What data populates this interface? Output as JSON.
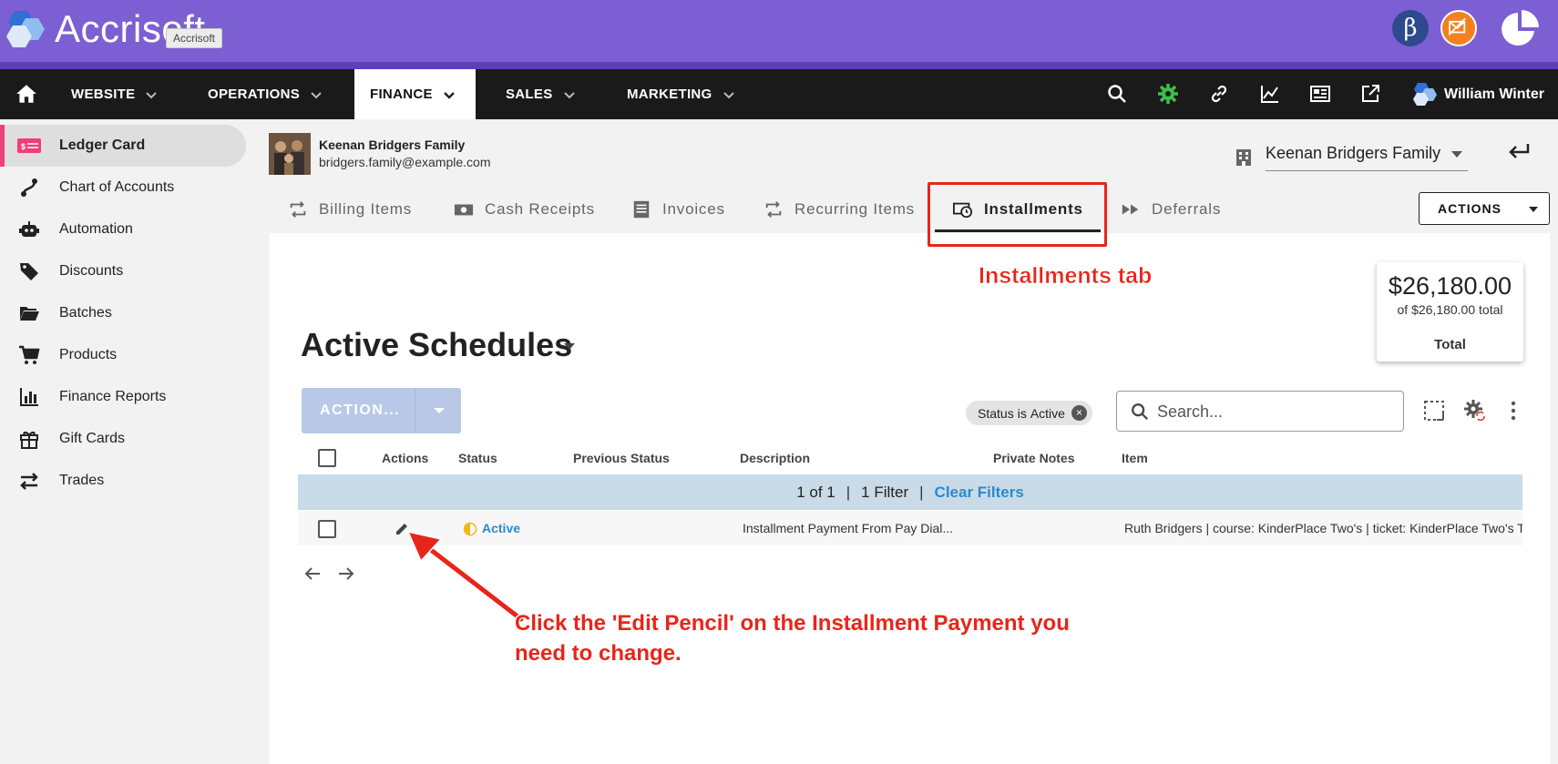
{
  "app": {
    "brand": "Accrisoft",
    "tooltip": "Accrisoft",
    "beta_glyph": "β",
    "colors": {
      "brand_purple": "#7b5fd3",
      "nav_dark": "#1a1a1a",
      "accent_pink": "#f03e7a",
      "link_blue": "#2a8ad1",
      "annotation_red": "#e8251b"
    }
  },
  "nav": {
    "items": [
      {
        "label": "WEBSITE"
      },
      {
        "label": "OPERATIONS"
      },
      {
        "label": "FINANCE"
      },
      {
        "label": "SALES"
      },
      {
        "label": "MARKETING"
      }
    ],
    "active": "FINANCE",
    "user": "William Winter",
    "icons": [
      "search-icon",
      "gear-icon",
      "link-icon",
      "analytics-icon",
      "newspaper-icon",
      "external-link-icon"
    ]
  },
  "sidebar": {
    "items": [
      {
        "label": "Ledger Card",
        "icon": "ledger-icon",
        "active": true
      },
      {
        "label": "Chart of Accounts",
        "icon": "chart-accounts-icon"
      },
      {
        "label": "Automation",
        "icon": "robot-icon"
      },
      {
        "label": "Discounts",
        "icon": "tag-icon"
      },
      {
        "label": "Batches",
        "icon": "folder-icon"
      },
      {
        "label": "Products",
        "icon": "cart-icon"
      },
      {
        "label": "Finance Reports",
        "icon": "bar-chart-icon"
      },
      {
        "label": "Gift Cards",
        "icon": "gift-icon"
      },
      {
        "label": "Trades",
        "icon": "swap-icon"
      }
    ]
  },
  "account": {
    "name": "Keenan Bridgers Family",
    "email": "bridgers.family@example.com",
    "selected": "Keenan Bridgers Family"
  },
  "tabs": [
    {
      "label": "Billing Items",
      "icon": "repeat-icon"
    },
    {
      "label": "Cash Receipts",
      "icon": "cash-icon"
    },
    {
      "label": "Invoices",
      "icon": "invoice-icon"
    },
    {
      "label": "Recurring Items",
      "icon": "repeat-icon"
    },
    {
      "label": "Installments",
      "icon": "installments-icon",
      "active": true
    },
    {
      "label": "Deferrals",
      "icon": "fast-forward-icon"
    }
  ],
  "actions_label": "ACTIONS",
  "total": {
    "amount": "$26,180.00",
    "sub": "of $26,180.00 total",
    "label": "Total"
  },
  "schedules": {
    "title": "Active Schedules",
    "action_label": "ACTION...",
    "filter_chip": {
      "field": "Status",
      "op": "is",
      "value": "Active"
    },
    "search_placeholder": "Search...",
    "columns": [
      "Actions",
      "Status",
      "Previous Status",
      "Description",
      "Private Notes",
      "Item"
    ],
    "filter_summary": {
      "count": "1 of 1",
      "filters": "1 Filter",
      "clear": "Clear Filters"
    },
    "rows": [
      {
        "status": "Active",
        "previous_status": "",
        "description": "Installment Payment From Pay Dial...",
        "private_notes": "",
        "item": "Ruth Bridgers | course: KinderPlace Two's | ticket: KinderPlace Two's Tuition"
      }
    ]
  },
  "annotations": {
    "tab_note": "Installments tab",
    "pencil_note_line1": "Click the 'Edit Pencil' on the Installment Payment you",
    "pencil_note_line2": "need to change."
  }
}
